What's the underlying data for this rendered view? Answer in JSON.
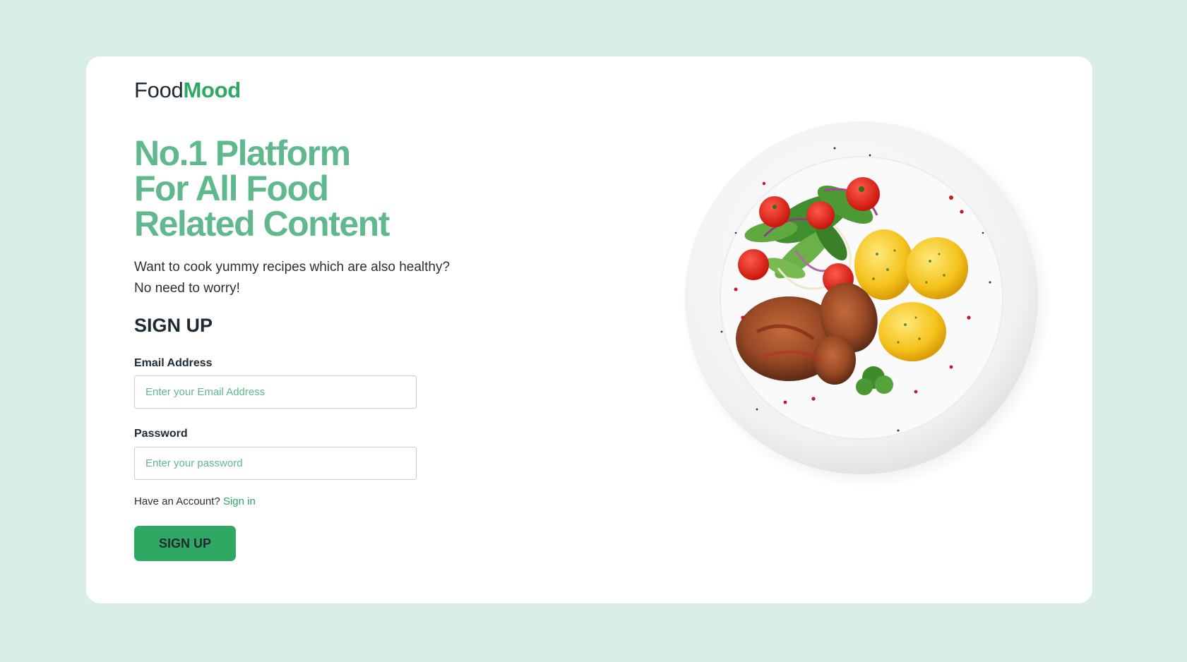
{
  "brand": {
    "name_primary": "Food",
    "name_accent": "Mood"
  },
  "hero": {
    "headline_lines": [
      "No.1 Platform",
      "For All Food",
      "Related Content"
    ],
    "subtitle_lines": [
      "Want to cook yummy recipes which are also healthy?",
      "No need to worry!"
    ]
  },
  "form": {
    "title": "SIGN UP",
    "email": {
      "label": "Email Address",
      "placeholder": "Enter your Email Address",
      "value": ""
    },
    "password": {
      "label": "Password",
      "placeholder": "Enter your password",
      "value": ""
    },
    "account_prompt": "Have an Account?",
    "signin_link": "Sign in",
    "submit_label": "SIGN UP"
  },
  "image": {
    "icon": "food-plate-image"
  },
  "colors": {
    "background": "#d9efe5",
    "card": "#ffffff",
    "accent": "#2ea862",
    "headline": "#5fb98c",
    "text_dark": "#1d2a33"
  }
}
